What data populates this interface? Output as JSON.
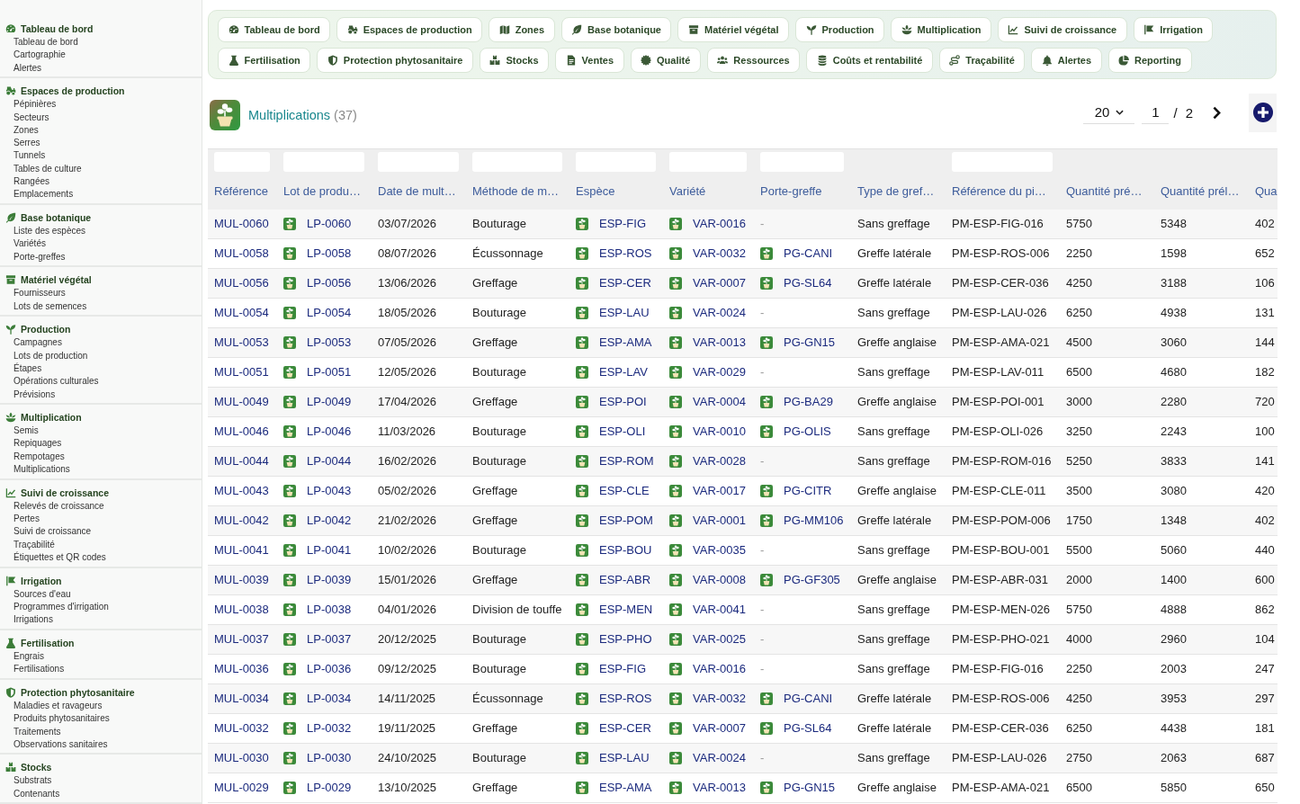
{
  "sidebar": {
    "sections": [
      {
        "title": "Tableau de bord",
        "items": [
          "Tableau de bord",
          "Cartographie",
          "Alertes"
        ]
      },
      {
        "title": "Espaces de production",
        "items": [
          "Pépinières",
          "Secteurs",
          "Zones",
          "Serres",
          "Tunnels",
          "Tables de culture",
          "Rangées",
          "Emplacements"
        ]
      },
      {
        "title": "Base botanique",
        "items": [
          "Liste des espèces",
          "Variétés",
          "Porte-greffes"
        ]
      },
      {
        "title": "Matériel végétal",
        "items": [
          "Fournisseurs",
          "Lots de semences"
        ]
      },
      {
        "title": "Production",
        "items": [
          "Campagnes",
          "Lots de production",
          "Étapes",
          "Opérations culturales",
          "Prévisions"
        ]
      },
      {
        "title": "Multiplication",
        "items": [
          "Semis",
          "Repiquages",
          "Rempotages",
          "Multiplications"
        ]
      },
      {
        "title": "Suivi de croissance",
        "items": [
          "Relevés de croissance",
          "Pertes",
          "Suivi de croissance",
          "Traçabilité",
          "Étiquettes et QR codes"
        ]
      },
      {
        "title": "Irrigation",
        "items": [
          "Sources d'eau",
          "Programmes d'irrigation",
          "Irrigations"
        ]
      },
      {
        "title": "Fertilisation",
        "items": [
          "Engrais",
          "Fertilisations"
        ]
      },
      {
        "title": "Protection phytosanitaire",
        "items": [
          "Maladies et ravageurs",
          "Produits phytosanitaires",
          "Traitements",
          "Observations sanitaires"
        ]
      },
      {
        "title": "Stocks",
        "items": [
          "Substrats",
          "Contenants"
        ]
      }
    ]
  },
  "module_nav": {
    "buttons": [
      "Tableau de bord",
      "Espaces de production",
      "Zones",
      "Base botanique",
      "Matériel végétal",
      "Production",
      "Multiplication",
      "Suivi de croissance",
      "Irrigation",
      "Fertilisation",
      "Protection phytosanitaire",
      "Stocks",
      "Ventes",
      "Qualité",
      "Ressources",
      "Coûts et rentabilité",
      "Traçabilité",
      "Alertes",
      "Reporting"
    ]
  },
  "page_header": {
    "title": "Multiplications",
    "count": "(37)"
  },
  "pagination": {
    "page_size": "20",
    "page": "1",
    "separator": "/",
    "page_count": "2"
  },
  "table": {
    "columns": [
      {
        "label": "Référence",
        "kind": "link",
        "has_filter": true
      },
      {
        "label": "Lot de produ…",
        "kind": "icon-link",
        "has_filter": true
      },
      {
        "label": "Date de mult…",
        "kind": "text",
        "has_filter": true
      },
      {
        "label": "Méthode de m…",
        "kind": "text",
        "has_filter": true
      },
      {
        "label": "Espèce",
        "kind": "icon-link",
        "has_filter": true
      },
      {
        "label": "Variété",
        "kind": "icon-link",
        "has_filter": true
      },
      {
        "label": "Porte-greffe",
        "kind": "rootstock",
        "has_filter": true
      },
      {
        "label": "Type de gref…",
        "kind": "text",
        "has_filter": false
      },
      {
        "label": "Référence du pi…",
        "kind": "text",
        "has_filter": true
      },
      {
        "label": "Quantité pré…",
        "kind": "text",
        "has_filter": false
      },
      {
        "label": "Quantité prél…",
        "kind": "text",
        "has_filter": false
      },
      {
        "label": "Qua",
        "kind": "text",
        "has_filter": false
      }
    ],
    "rows": [
      {
        "cells": [
          "MUL-0060",
          "LP-0060",
          "03/07/2026",
          "Bouturage",
          "ESP-FIG",
          "VAR-0016",
          "-",
          "Sans greffage",
          "PM-ESP-FIG-016",
          "5750",
          "5348",
          "402"
        ],
        "has_rootstock": false
      },
      {
        "cells": [
          "MUL-0058",
          "LP-0058",
          "08/07/2026",
          "Écussonnage",
          "ESP-ROS",
          "VAR-0032",
          "PG-CANI",
          "Greffe latérale",
          "PM-ESP-ROS-006",
          "2250",
          "1598",
          "652"
        ],
        "has_rootstock": true
      },
      {
        "cells": [
          "MUL-0056",
          "LP-0056",
          "13/06/2026",
          "Greffage",
          "ESP-CER",
          "VAR-0007",
          "PG-SL64",
          "Greffe latérale",
          "PM-ESP-CER-036",
          "4250",
          "3188",
          "106"
        ],
        "has_rootstock": true
      },
      {
        "cells": [
          "MUL-0054",
          "LP-0054",
          "18/05/2026",
          "Bouturage",
          "ESP-LAU",
          "VAR-0024",
          "-",
          "Sans greffage",
          "PM-ESP-LAU-026",
          "6250",
          "4938",
          "131"
        ],
        "has_rootstock": false
      },
      {
        "cells": [
          "MUL-0053",
          "LP-0053",
          "07/05/2026",
          "Greffage",
          "ESP-AMA",
          "VAR-0013",
          "PG-GN15",
          "Greffe anglaise",
          "PM-ESP-AMA-021",
          "4500",
          "3060",
          "144"
        ],
        "has_rootstock": true
      },
      {
        "cells": [
          "MUL-0051",
          "LP-0051",
          "12/05/2026",
          "Bouturage",
          "ESP-LAV",
          "VAR-0029",
          "-",
          "Sans greffage",
          "PM-ESP-LAV-011",
          "6500",
          "4680",
          "182"
        ],
        "has_rootstock": false
      },
      {
        "cells": [
          "MUL-0049",
          "LP-0049",
          "17/04/2026",
          "Greffage",
          "ESP-POI",
          "VAR-0004",
          "PG-BA29",
          "Greffe anglaise",
          "PM-ESP-POI-001",
          "3000",
          "2280",
          "720"
        ],
        "has_rootstock": true
      },
      {
        "cells": [
          "MUL-0046",
          "LP-0046",
          "11/03/2026",
          "Bouturage",
          "ESP-OLI",
          "VAR-0010",
          "PG-OLIS",
          "Sans greffage",
          "PM-ESP-OLI-026",
          "3250",
          "2243",
          "100"
        ],
        "has_rootstock": true
      },
      {
        "cells": [
          "MUL-0044",
          "LP-0044",
          "16/02/2026",
          "Bouturage",
          "ESP-ROM",
          "VAR-0028",
          "-",
          "Sans greffage",
          "PM-ESP-ROM-016",
          "5250",
          "3833",
          "141"
        ],
        "has_rootstock": false
      },
      {
        "cells": [
          "MUL-0043",
          "LP-0043",
          "05/02/2026",
          "Greffage",
          "ESP-CLE",
          "VAR-0017",
          "PG-CITR",
          "Greffe anglaise",
          "PM-ESP-CLE-011",
          "3500",
          "3080",
          "420"
        ],
        "has_rootstock": true
      },
      {
        "cells": [
          "MUL-0042",
          "LP-0042",
          "21/02/2026",
          "Greffage",
          "ESP-POM",
          "VAR-0001",
          "PG-MM106",
          "Greffe latérale",
          "PM-ESP-POM-006",
          "1750",
          "1348",
          "402"
        ],
        "has_rootstock": true
      },
      {
        "cells": [
          "MUL-0041",
          "LP-0041",
          "10/02/2026",
          "Bouturage",
          "ESP-BOU",
          "VAR-0035",
          "-",
          "Sans greffage",
          "PM-ESP-BOU-001",
          "5500",
          "5060",
          "440"
        ],
        "has_rootstock": false
      },
      {
        "cells": [
          "MUL-0039",
          "LP-0039",
          "15/01/2026",
          "Greffage",
          "ESP-ABR",
          "VAR-0008",
          "PG-GF305",
          "Greffe anglaise",
          "PM-ESP-ABR-031",
          "2000",
          "1400",
          "600"
        ],
        "has_rootstock": true
      },
      {
        "cells": [
          "MUL-0038",
          "LP-0038",
          "04/01/2026",
          "Division de touffe",
          "ESP-MEN",
          "VAR-0041",
          "-",
          "Sans greffage",
          "PM-ESP-MEN-026",
          "5750",
          "4888",
          "862"
        ],
        "has_rootstock": false
      },
      {
        "cells": [
          "MUL-0037",
          "LP-0037",
          "20/12/2025",
          "Bouturage",
          "ESP-PHO",
          "VAR-0025",
          "-",
          "Sans greffage",
          "PM-ESP-PHO-021",
          "4000",
          "2960",
          "104"
        ],
        "has_rootstock": false
      },
      {
        "cells": [
          "MUL-0036",
          "LP-0036",
          "09/12/2025",
          "Bouturage",
          "ESP-FIG",
          "VAR-0016",
          "-",
          "Sans greffage",
          "PM-ESP-FIG-016",
          "2250",
          "2003",
          "247"
        ],
        "has_rootstock": false
      },
      {
        "cells": [
          "MUL-0034",
          "LP-0034",
          "14/11/2025",
          "Écussonnage",
          "ESP-ROS",
          "VAR-0032",
          "PG-CANI",
          "Greffe latérale",
          "PM-ESP-ROS-006",
          "4250",
          "3953",
          "297"
        ],
        "has_rootstock": true
      },
      {
        "cells": [
          "MUL-0032",
          "LP-0032",
          "19/11/2025",
          "Greffage",
          "ESP-CER",
          "VAR-0007",
          "PG-SL64",
          "Greffe latérale",
          "PM-ESP-CER-036",
          "6250",
          "4438",
          "181"
        ],
        "has_rootstock": true
      },
      {
        "cells": [
          "MUL-0030",
          "LP-0030",
          "24/10/2025",
          "Bouturage",
          "ESP-LAU",
          "VAR-0024",
          "-",
          "Sans greffage",
          "PM-ESP-LAU-026",
          "2750",
          "2063",
          "687"
        ],
        "has_rootstock": false
      },
      {
        "cells": [
          "MUL-0029",
          "LP-0029",
          "13/10/2025",
          "Greffage",
          "ESP-AMA",
          "VAR-0013",
          "PG-GN15",
          "Greffe anglaise",
          "PM-ESP-AMA-021",
          "6500",
          "5850",
          "650"
        ],
        "has_rootstock": true
      }
    ]
  }
}
